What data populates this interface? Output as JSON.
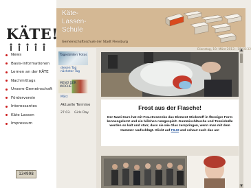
{
  "logo": {
    "text": "KÄTE!"
  },
  "header": {
    "school_line1": "Käte-",
    "school_line2": "Lassen-",
    "school_line3": "Schule",
    "school_sub": "Gemeinschaftsschule der Stadt Flensburg"
  },
  "nav": {
    "items": [
      {
        "label": "News"
      },
      {
        "label": "Basis-Informationen"
      },
      {
        "label": "Lernen an der KÄTE"
      },
      {
        "label": "Nachmittags"
      },
      {
        "label": "Unsere Gemeinschaft"
      },
      {
        "label": "Förderverein"
      },
      {
        "label": "Interessantes"
      },
      {
        "label": "Käte Lassen"
      },
      {
        "label": "Impressum"
      }
    ]
  },
  "counter": {
    "value": "134998"
  },
  "sidebar": {
    "thumb1_caption": "Tagesbilder/ Fotos",
    "prev_day": "diesen Tag",
    "next_day": "nächster Tag",
    "thumb2_caption": "MENÜ DER WOCHE",
    "month": "März",
    "aktuelle_termine": "Aktuelle Termine",
    "termin_date": "27.03.",
    "termin_label": "Girls Day"
  },
  "content": {
    "date": "Dienstag, 19. März 2013 - 15:18:32",
    "title": "Frost aus der Flasche!",
    "body_pre": "Der Nawi-Kurs hat mit Frau Evseenko das Element Stickstoff in flüssiger Form kennengelernt und ein bißchen rumgespielt. Gummischläuche und Tennisbälle werden so kalt und starr, dass sie wie Glas zerspringen, wenn man mit dem Hammer raufschlägt. Klickt auf ",
    "film_link": "FILM",
    "body_post": " und schaut euch das an!"
  }
}
